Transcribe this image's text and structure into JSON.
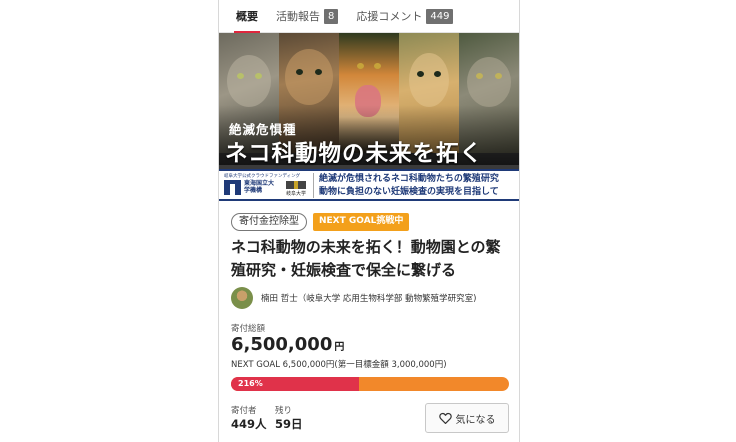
{
  "tabs": [
    {
      "label": "概要",
      "active": true
    },
    {
      "label": "活動報告",
      "count": "8"
    },
    {
      "label": "応援コメント",
      "count": "449"
    }
  ],
  "hero": {
    "subtitle": "絶滅危惧種",
    "title": "ネコ科動物の未来を拓く",
    "logo_caption": "岐阜大学公式クラウドファンディング",
    "logo_org": "東海国立大学機構",
    "logo_univ": "岐阜大学",
    "band_line1": "絶滅が危惧されるネコ科動物たちの繁殖研究",
    "band_line2": "動物に負担のない妊娠検査の実現を目指して"
  },
  "badges": {
    "tax": "寄付金控除型",
    "next_goal": "NEXT GOAL挑戦中"
  },
  "project_title": "ネコ科動物の未来を拓く！動物園との繁殖研究・妊娠検査で保全に繋げる",
  "author": "楠田 哲士（岐阜大学 応用生物科学部 動物繁殖学研究室)",
  "stats": {
    "total_label": "寄付総額",
    "total_value": "6,500,000",
    "total_unit": "円",
    "next_goal_text": "NEXT GOAL 6,500,000円(第一目標金額 3,000,000円)",
    "progress_label": "216%",
    "progress_fill_fraction": 0.46,
    "donors_label": "寄付者",
    "donors_value": "449人",
    "remaining_label": "残り",
    "remaining_value": "59日"
  },
  "favorite_label": "気になる",
  "colors": {
    "accent_red": "#e0324a",
    "accent_orange": "#f2882a",
    "goal_badge": "#f3a01b",
    "band_navy": "#1f3a78"
  }
}
